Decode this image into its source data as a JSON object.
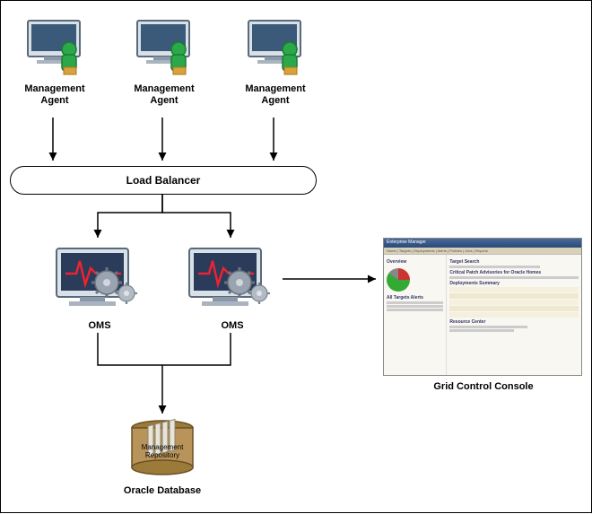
{
  "agents": [
    {
      "label": "Management Agent"
    },
    {
      "label": "Management Agent"
    },
    {
      "label": "Management Agent"
    }
  ],
  "load_balancer": {
    "label": "Load Balancer"
  },
  "oms": [
    {
      "label": "OMS"
    },
    {
      "label": "OMS"
    }
  ],
  "repository": {
    "inner_label": "Management Repository",
    "outer_label": "Oracle Database"
  },
  "console": {
    "title": "Enterprise Manager",
    "caption": "Grid Control Console",
    "tabs": "Home | Targets | Deployments | Alerts | Policies | Jobs | Reports",
    "sections": {
      "overview": "Overview",
      "targets": "Target Search",
      "all_targets": "All Targets Alerts",
      "critical_patch": "Critical Patch Advisories for Oracle Homes",
      "deployments": "Deployments Summary",
      "resource": "Resource Center"
    }
  },
  "icons": {
    "agent": "management-agent-icon",
    "oms": "oms-server-icon",
    "db": "database-cylinder-icon"
  }
}
